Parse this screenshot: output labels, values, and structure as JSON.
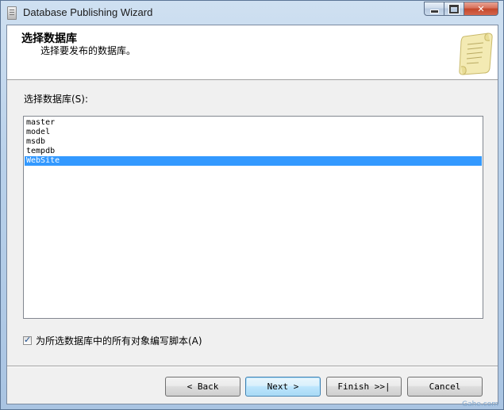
{
  "window": {
    "title": "Database Publishing Wizard"
  },
  "header": {
    "title": "选择数据库",
    "subtitle": "选择要发布的数据库。"
  },
  "database_list": {
    "label": "选择数据库(S):",
    "items": [
      "master",
      "model",
      "msdb",
      "tempdb",
      "WebSite"
    ],
    "selected": "WebSite"
  },
  "script_all_checkbox": {
    "label": "为所选数据库中的所有对象编写脚本(A)",
    "checked": true
  },
  "buttons": {
    "back": "< Back",
    "next": "Next >",
    "finish": "Finish >>|",
    "cancel": "Cancel"
  },
  "colors": {
    "selection": "#3399ff",
    "window_frame": "#b9d1ea",
    "close_button": "#c4472b"
  },
  "watermark": "Gahe.com"
}
